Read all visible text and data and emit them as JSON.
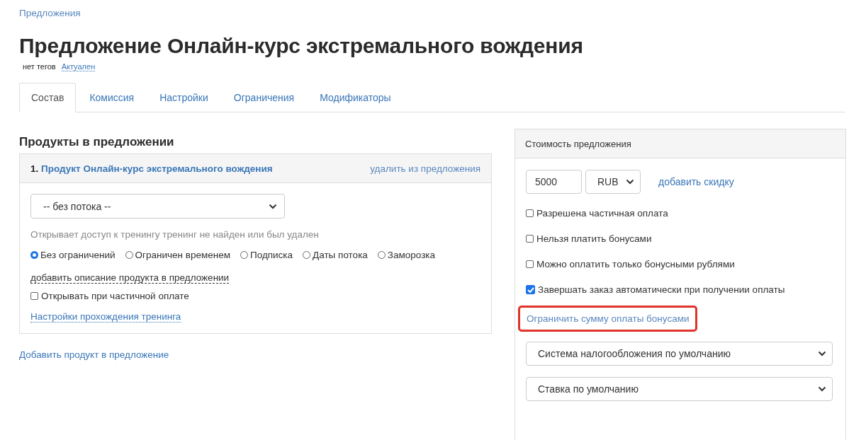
{
  "breadcrumb": "Предложения",
  "title": "Предложение Онлайн-курс экстремального вождения",
  "tags": {
    "label": "нет тегов",
    "status": "Актуален"
  },
  "tabs": [
    {
      "label": "Состав",
      "selected": true
    },
    {
      "label": "Комиссия",
      "selected": false
    },
    {
      "label": "Настройки",
      "selected": false
    },
    {
      "label": "Ограничения",
      "selected": false
    },
    {
      "label": "Модификаторы",
      "selected": false
    }
  ],
  "products": {
    "heading": "Продукты в предложении",
    "items": [
      {
        "number": "1.",
        "name": "Продукт Онлайн-курс экстремального вождения",
        "remove": "удалить из предложения",
        "stream": "-- без потока --",
        "note": "Открывает доступ к тренингу тренинг не найден или был удален",
        "access": [
          {
            "label": "Без ограничений",
            "selected": true
          },
          {
            "label": "Ограничен временем",
            "selected": false
          },
          {
            "label": "Подписка",
            "selected": false
          },
          {
            "label": "Даты потока",
            "selected": false
          },
          {
            "label": "Заморозка",
            "selected": false
          }
        ],
        "add_description": "добавить описание продукта в предложении",
        "open_partial": {
          "label": "Открывать при частичной оплате",
          "checked": false
        },
        "training_settings": "Настройки прохождения тренинга"
      }
    ],
    "add": "Добавить продукт в предложение"
  },
  "price": {
    "heading": "Стоимость предложения",
    "amount": "5000",
    "currency": "RUB",
    "discount": "добавить скидку",
    "options": [
      {
        "label": "Разрешена частичная оплата",
        "checked": false
      },
      {
        "label": "Нельзя платить бонусами",
        "checked": false
      },
      {
        "label": "Можно оплатить только бонусными рублями",
        "checked": false
      },
      {
        "label": "Завершать заказ автоматически при получении оплаты",
        "checked": true
      }
    ],
    "bonus_limit": {
      "label": "Ограничить сумму оплаты бонусами",
      "highlighted": true
    },
    "tax_system": "Система налогообложения по умолчанию",
    "tax_rate": "Ставка по умолчанию"
  }
}
